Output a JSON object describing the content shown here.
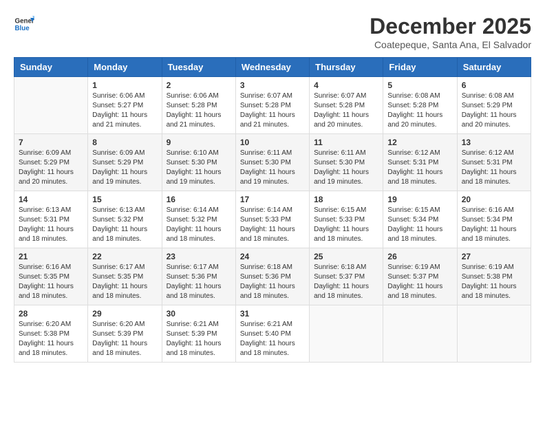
{
  "logo": {
    "line1": "General",
    "line2": "Blue"
  },
  "title": "December 2025",
  "subtitle": "Coatepeque, Santa Ana, El Salvador",
  "weekdays": [
    "Sunday",
    "Monday",
    "Tuesday",
    "Wednesday",
    "Thursday",
    "Friday",
    "Saturday"
  ],
  "weeks": [
    [
      {
        "day": "",
        "sunrise": "",
        "sunset": "",
        "daylight": ""
      },
      {
        "day": "1",
        "sunrise": "Sunrise: 6:06 AM",
        "sunset": "Sunset: 5:27 PM",
        "daylight": "Daylight: 11 hours and 21 minutes."
      },
      {
        "day": "2",
        "sunrise": "Sunrise: 6:06 AM",
        "sunset": "Sunset: 5:28 PM",
        "daylight": "Daylight: 11 hours and 21 minutes."
      },
      {
        "day": "3",
        "sunrise": "Sunrise: 6:07 AM",
        "sunset": "Sunset: 5:28 PM",
        "daylight": "Daylight: 11 hours and 21 minutes."
      },
      {
        "day": "4",
        "sunrise": "Sunrise: 6:07 AM",
        "sunset": "Sunset: 5:28 PM",
        "daylight": "Daylight: 11 hours and 20 minutes."
      },
      {
        "day": "5",
        "sunrise": "Sunrise: 6:08 AM",
        "sunset": "Sunset: 5:28 PM",
        "daylight": "Daylight: 11 hours and 20 minutes."
      },
      {
        "day": "6",
        "sunrise": "Sunrise: 6:08 AM",
        "sunset": "Sunset: 5:29 PM",
        "daylight": "Daylight: 11 hours and 20 minutes."
      }
    ],
    [
      {
        "day": "7",
        "sunrise": "Sunrise: 6:09 AM",
        "sunset": "Sunset: 5:29 PM",
        "daylight": "Daylight: 11 hours and 20 minutes."
      },
      {
        "day": "8",
        "sunrise": "Sunrise: 6:09 AM",
        "sunset": "Sunset: 5:29 PM",
        "daylight": "Daylight: 11 hours and 19 minutes."
      },
      {
        "day": "9",
        "sunrise": "Sunrise: 6:10 AM",
        "sunset": "Sunset: 5:30 PM",
        "daylight": "Daylight: 11 hours and 19 minutes."
      },
      {
        "day": "10",
        "sunrise": "Sunrise: 6:11 AM",
        "sunset": "Sunset: 5:30 PM",
        "daylight": "Daylight: 11 hours and 19 minutes."
      },
      {
        "day": "11",
        "sunrise": "Sunrise: 6:11 AM",
        "sunset": "Sunset: 5:30 PM",
        "daylight": "Daylight: 11 hours and 19 minutes."
      },
      {
        "day": "12",
        "sunrise": "Sunrise: 6:12 AM",
        "sunset": "Sunset: 5:31 PM",
        "daylight": "Daylight: 11 hours and 18 minutes."
      },
      {
        "day": "13",
        "sunrise": "Sunrise: 6:12 AM",
        "sunset": "Sunset: 5:31 PM",
        "daylight": "Daylight: 11 hours and 18 minutes."
      }
    ],
    [
      {
        "day": "14",
        "sunrise": "Sunrise: 6:13 AM",
        "sunset": "Sunset: 5:31 PM",
        "daylight": "Daylight: 11 hours and 18 minutes."
      },
      {
        "day": "15",
        "sunrise": "Sunrise: 6:13 AM",
        "sunset": "Sunset: 5:32 PM",
        "daylight": "Daylight: 11 hours and 18 minutes."
      },
      {
        "day": "16",
        "sunrise": "Sunrise: 6:14 AM",
        "sunset": "Sunset: 5:32 PM",
        "daylight": "Daylight: 11 hours and 18 minutes."
      },
      {
        "day": "17",
        "sunrise": "Sunrise: 6:14 AM",
        "sunset": "Sunset: 5:33 PM",
        "daylight": "Daylight: 11 hours and 18 minutes."
      },
      {
        "day": "18",
        "sunrise": "Sunrise: 6:15 AM",
        "sunset": "Sunset: 5:33 PM",
        "daylight": "Daylight: 11 hours and 18 minutes."
      },
      {
        "day": "19",
        "sunrise": "Sunrise: 6:15 AM",
        "sunset": "Sunset: 5:34 PM",
        "daylight": "Daylight: 11 hours and 18 minutes."
      },
      {
        "day": "20",
        "sunrise": "Sunrise: 6:16 AM",
        "sunset": "Sunset: 5:34 PM",
        "daylight": "Daylight: 11 hours and 18 minutes."
      }
    ],
    [
      {
        "day": "21",
        "sunrise": "Sunrise: 6:16 AM",
        "sunset": "Sunset: 5:35 PM",
        "daylight": "Daylight: 11 hours and 18 minutes."
      },
      {
        "day": "22",
        "sunrise": "Sunrise: 6:17 AM",
        "sunset": "Sunset: 5:35 PM",
        "daylight": "Daylight: 11 hours and 18 minutes."
      },
      {
        "day": "23",
        "sunrise": "Sunrise: 6:17 AM",
        "sunset": "Sunset: 5:36 PM",
        "daylight": "Daylight: 11 hours and 18 minutes."
      },
      {
        "day": "24",
        "sunrise": "Sunrise: 6:18 AM",
        "sunset": "Sunset: 5:36 PM",
        "daylight": "Daylight: 11 hours and 18 minutes."
      },
      {
        "day": "25",
        "sunrise": "Sunrise: 6:18 AM",
        "sunset": "Sunset: 5:37 PM",
        "daylight": "Daylight: 11 hours and 18 minutes."
      },
      {
        "day": "26",
        "sunrise": "Sunrise: 6:19 AM",
        "sunset": "Sunset: 5:37 PM",
        "daylight": "Daylight: 11 hours and 18 minutes."
      },
      {
        "day": "27",
        "sunrise": "Sunrise: 6:19 AM",
        "sunset": "Sunset: 5:38 PM",
        "daylight": "Daylight: 11 hours and 18 minutes."
      }
    ],
    [
      {
        "day": "28",
        "sunrise": "Sunrise: 6:20 AM",
        "sunset": "Sunset: 5:38 PM",
        "daylight": "Daylight: 11 hours and 18 minutes."
      },
      {
        "day": "29",
        "sunrise": "Sunrise: 6:20 AM",
        "sunset": "Sunset: 5:39 PM",
        "daylight": "Daylight: 11 hours and 18 minutes."
      },
      {
        "day": "30",
        "sunrise": "Sunrise: 6:21 AM",
        "sunset": "Sunset: 5:39 PM",
        "daylight": "Daylight: 11 hours and 18 minutes."
      },
      {
        "day": "31",
        "sunrise": "Sunrise: 6:21 AM",
        "sunset": "Sunset: 5:40 PM",
        "daylight": "Daylight: 11 hours and 18 minutes."
      },
      {
        "day": "",
        "sunrise": "",
        "sunset": "",
        "daylight": ""
      },
      {
        "day": "",
        "sunrise": "",
        "sunset": "",
        "daylight": ""
      },
      {
        "day": "",
        "sunrise": "",
        "sunset": "",
        "daylight": ""
      }
    ]
  ]
}
